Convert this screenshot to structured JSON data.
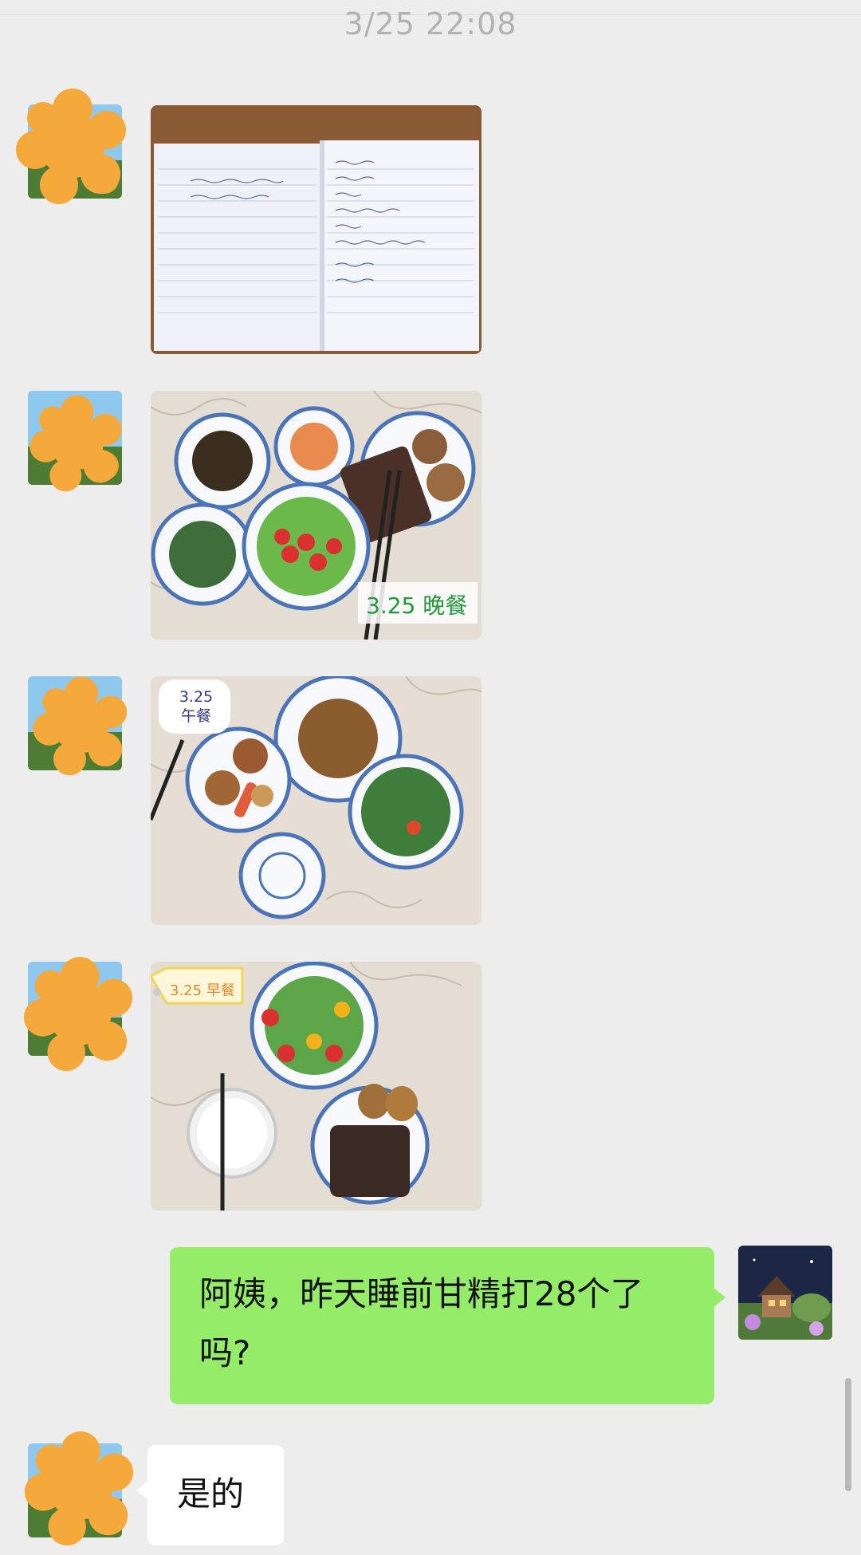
{
  "chat": {
    "timestamp": "3/25 22:08",
    "messages": [
      {
        "type": "image",
        "sender": "other",
        "content": "handwritten notebook log"
      },
      {
        "type": "image",
        "sender": "other",
        "label": "3.25 晚餐"
      },
      {
        "type": "image",
        "sender": "other",
        "label": "3.25 午餐"
      },
      {
        "type": "image",
        "sender": "other",
        "label": "3.25 早餐"
      },
      {
        "type": "text",
        "sender": "me",
        "text": "阿姨，昨天睡前甘精打28个了吗?"
      },
      {
        "type": "text",
        "sender": "other",
        "text": "是的"
      }
    ]
  },
  "photos": {
    "dinner_label": "3.25 晚餐",
    "lunch_label_line1": "3.25",
    "lunch_label_line2": "午餐",
    "breakfast_label": "3.25 早餐"
  },
  "colors": {
    "background": "#ededed",
    "my_bubble": "#95ec69",
    "their_bubble": "#ffffff",
    "redaction": "#f6a93b"
  },
  "icons": {
    "avatar_other": "sunflower-avatar-icon",
    "avatar_me": "cottage-avatar-icon"
  }
}
